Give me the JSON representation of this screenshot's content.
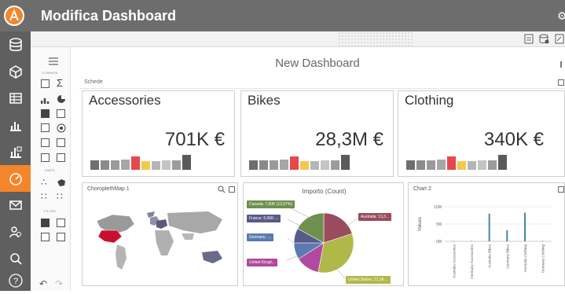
{
  "app": {
    "title": "Modifica Dashboard"
  },
  "dashboard": {
    "title": "New Dashboard",
    "group_label": "Schede",
    "cards": [
      {
        "title": "Accessories",
        "value": "701K €"
      },
      {
        "title": "Bikes",
        "value": "28,3M €"
      },
      {
        "title": "Clothing",
        "value": "340K €"
      }
    ],
    "sparkline_colors": [
      "#6e6e6e",
      "#8a8a8a",
      "#9a9a9a",
      "#a6a6a6",
      "#e8474c",
      "#f2c94c",
      "#b5b5b5",
      "#c4c4c4",
      "#9c9c9c",
      "#5a5a5a"
    ],
    "sparkline_levels": [
      0.6,
      0.6,
      0.6,
      0.65,
      0.85,
      0.55,
      0.55,
      0.6,
      0.6,
      0.95
    ]
  },
  "toolbox": {
    "sections": [
      "COMMON",
      "MAPS",
      "FILTER"
    ]
  },
  "panels": {
    "map_title": "ChoroplethMap 1",
    "pie_title": "Importo (Count)",
    "chart_title": "Chart 2"
  },
  "pie": {
    "labels": {
      "canada": "Canada: 7,60K (12,67%)",
      "france": "France: 5,56K ...",
      "germany": "Germany: ...",
      "uk": "United Kingd...",
      "australia": "Australia: 13,3...",
      "us": "United States: 21,3K ..."
    }
  },
  "chart_data": {
    "type": "bar",
    "title": "Chart 2",
    "xlabel": "",
    "ylabel": "Values",
    "yticks": [
      "0M",
      "5M",
      "10M"
    ],
    "ylim": [
      0,
      10
    ],
    "categories": [
      "Australia Accessories",
      "Germany Accessories",
      "Australia Bikes",
      "Germany Bikes",
      "Australia Clothing",
      "Germany Clothing"
    ],
    "values": [
      0.1,
      0.1,
      8.0,
      3.2,
      8.3,
      0.1
    ]
  },
  "colors": {
    "accent": "#f3852a",
    "titlebar": "#6d6d6d",
    "rail": "#5f5f5f",
    "bar": "#4a86a8"
  }
}
